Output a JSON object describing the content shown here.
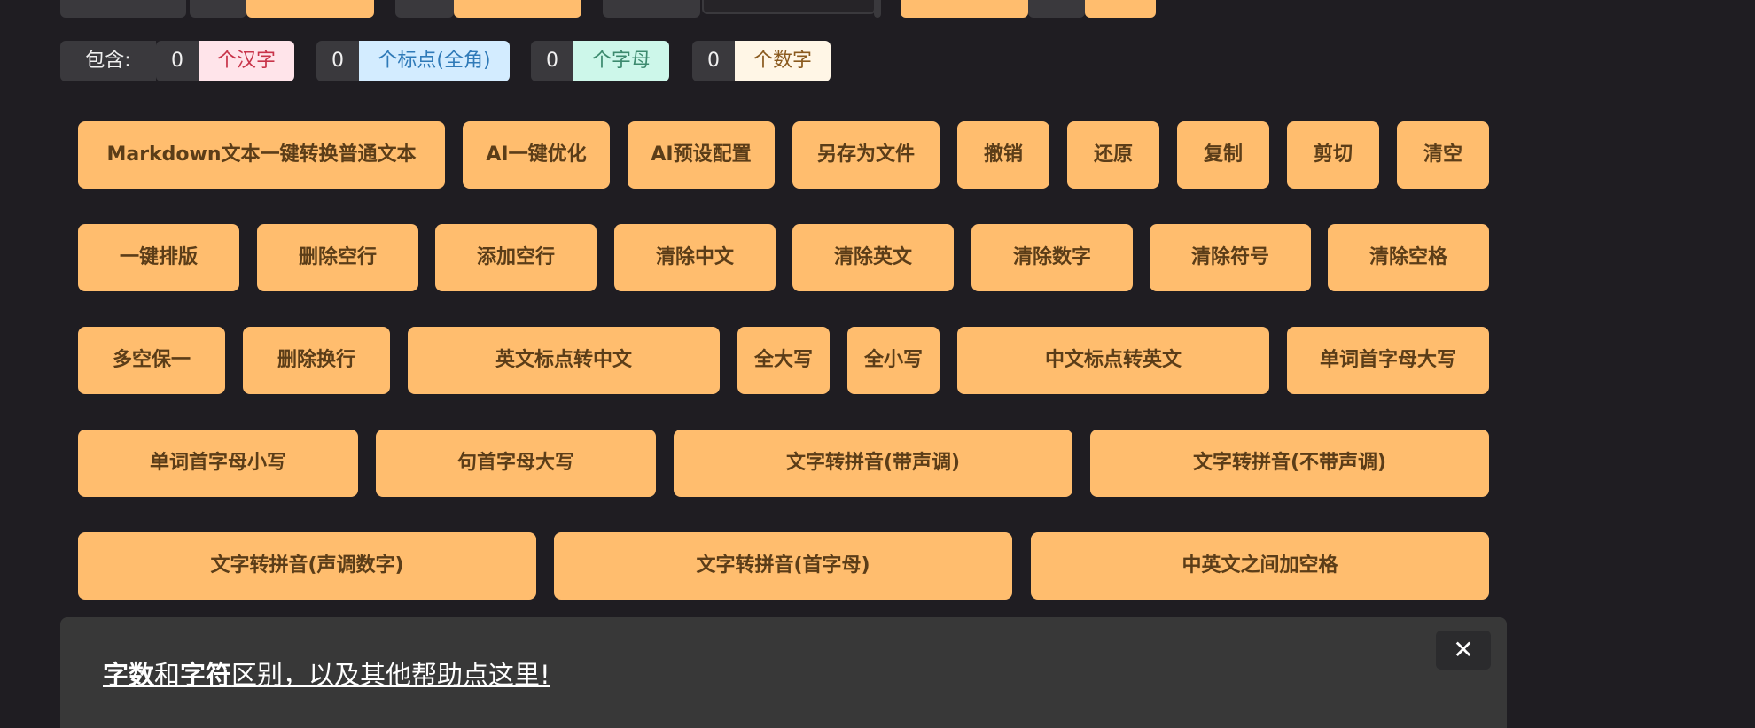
{
  "stats": {
    "lead": "包含:",
    "items": [
      {
        "count": "0",
        "label": "个汉字",
        "bg": "#ffe4ea",
        "fg": "#c8344a"
      },
      {
        "count": "0",
        "label": "个标点(全角)",
        "bg": "#d3ecff",
        "fg": "#2f7ab8"
      },
      {
        "count": "0",
        "label": "个字母",
        "bg": "#cdf7ea",
        "fg": "#3c8a6e"
      },
      {
        "count": "0",
        "label": "个数字",
        "bg": "#fff6e6",
        "fg": "#8a5a1e"
      }
    ]
  },
  "buttons": {
    "md_to_text": "Markdown文本一键转换普通文本",
    "ai_optimize": "AI一键优化",
    "ai_preset": "AI预设配置",
    "save_as_file": "另存为文件",
    "undo": "撤销",
    "restore": "还原",
    "copy": "复制",
    "cut": "剪切",
    "clear": "清空",
    "one_click_format": "一键排版",
    "delete_blank_lines": "删除空行",
    "add_blank_lines": "添加空行",
    "remove_chinese": "清除中文",
    "remove_english": "清除英文",
    "remove_digits": "清除数字",
    "remove_symbols": "清除符号",
    "remove_spaces": "清除空格",
    "collapse_spaces": "多空保一",
    "delete_line_breaks": "删除换行",
    "en_punct_to_cn": "英文标点转中文",
    "all_upper": "全大写",
    "all_lower": "全小写",
    "cn_punct_to_en": "中文标点转英文",
    "word_capitalize": "单词首字母大写",
    "word_lowercase": "单词首字母小写",
    "sentence_capitalize": "句首字母大写",
    "pinyin_tone": "文字转拼音(带声调)",
    "pinyin_no_tone": "文字转拼音(不带声调)",
    "pinyin_tone_number": "文字转拼音(声调数字)",
    "pinyin_initials": "文字转拼音(首字母)",
    "space_between_cn_en": "中英文之间加空格"
  },
  "banner": {
    "part1": "字数",
    "part2": "和",
    "part3": "字符",
    "part4": "区别，以及其他帮助点这里!",
    "close": "✕"
  }
}
